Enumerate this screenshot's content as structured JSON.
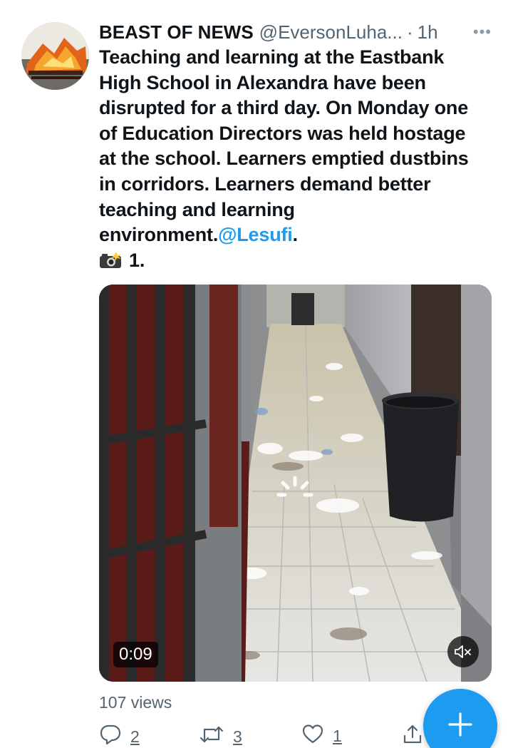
{
  "tweet": {
    "author_name": "BEAST OF NEWS",
    "author_handle": "@EversonLuha...",
    "separator": "·",
    "time": "1h",
    "more_label": "•••",
    "text_lines": [
      "Teaching and learning at the Eastbank",
      "High School in Alexandra have been",
      "disrupted for a third day. On Monday one",
      "of Education Directors was held hostage",
      "at the school. Learners emptied dustbins",
      "in corridors. Learners demand better",
      "teaching and learning"
    ],
    "last_line_prefix": "environment.",
    "mention": "@Lesufi",
    "last_line_suffix": ".",
    "caption": "1.",
    "media": {
      "duration": "0:09"
    },
    "views": "107 views",
    "stats": {
      "replies": "2",
      "retweets": "3",
      "likes": "1"
    }
  },
  "icons": {
    "camera": "camera-flash-icon",
    "reply": "reply-icon",
    "retweet": "retweet-icon",
    "like": "heart-icon",
    "share": "share-icon",
    "mute": "mute-icon",
    "compose": "plus-icon",
    "more": "more-icon"
  },
  "colors": {
    "accent": "#1d9bf0",
    "text": "#0f1419",
    "secondary": "#536471"
  }
}
